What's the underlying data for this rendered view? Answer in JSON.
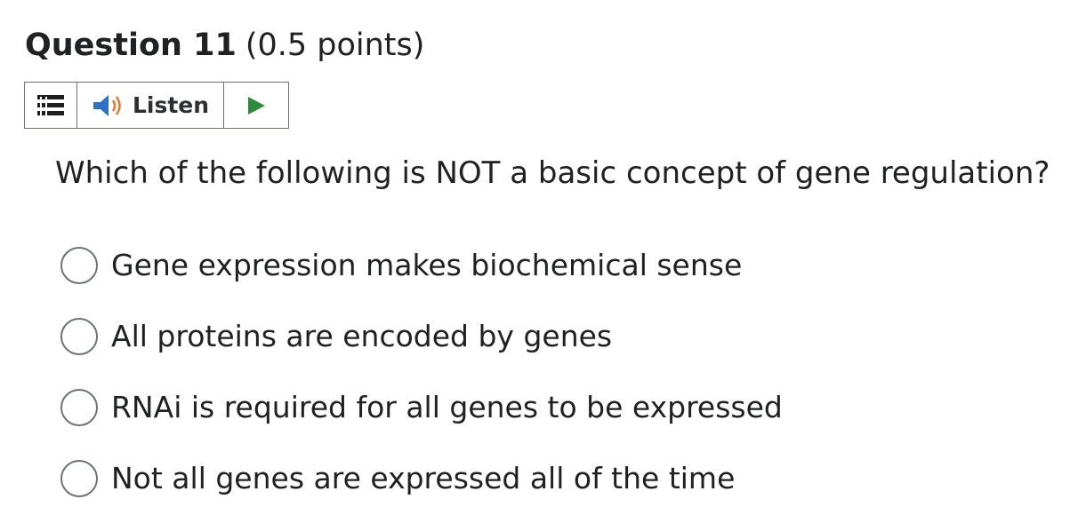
{
  "question": {
    "title": "Question 11",
    "points": "(0.5 points)"
  },
  "toolbar": {
    "menu_icon": "menu-icon",
    "listen_icon": "speaker-icon",
    "listen_label": "Listen",
    "play_icon": "play-icon",
    "play_color": "#2e8b3a",
    "speaker_color": "#2d6fc9",
    "wave_color": "#e57a2f"
  },
  "prompt": "Which of the following is NOT a basic concept of gene regulation?",
  "options": [
    {
      "label": "Gene expression makes biochemical sense",
      "selected": false
    },
    {
      "label": "All proteins are encoded by genes",
      "selected": false
    },
    {
      "label": "RNAi is required for all genes to be expressed",
      "selected": false
    },
    {
      "label": "Not all genes are expressed all of the time",
      "selected": false
    }
  ]
}
